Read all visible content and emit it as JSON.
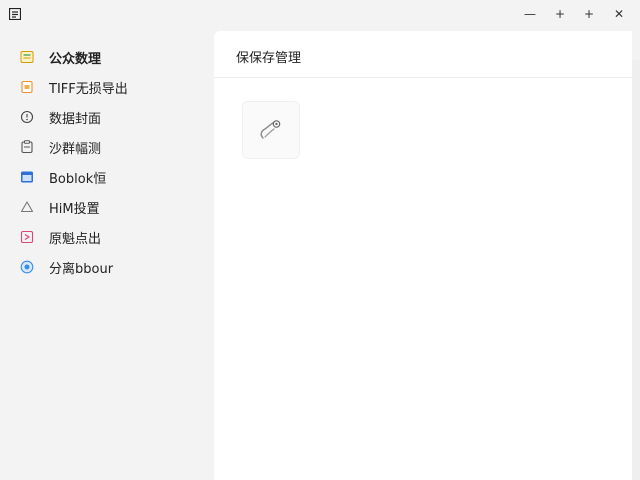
{
  "window": {
    "icon": "app-menu-icon",
    "controls": {
      "minimize": "—",
      "maximize": "+",
      "restore": "+",
      "close": "✕"
    }
  },
  "sidebar": {
    "items": [
      {
        "label": "公众数理",
        "icon": "notebook-icon",
        "active": true,
        "color": "#e0a800"
      },
      {
        "label": "TIFF无损导出",
        "icon": "file-orange-icon",
        "active": false,
        "color": "#e8912f"
      },
      {
        "label": "数据封面",
        "icon": "circle-clock-icon",
        "active": false,
        "color": "#444444"
      },
      {
        "label": "沙群幅测",
        "icon": "clipboard-icon",
        "active": false,
        "color": "#555555"
      },
      {
        "label": "Boblok恒",
        "icon": "window-blue-icon",
        "active": false,
        "color": "#2f6fd6"
      },
      {
        "label": "HiM投置",
        "icon": "triangle-icon",
        "active": false,
        "color": "#777777"
      },
      {
        "label": "原魁点出",
        "icon": "export-pink-icon",
        "active": false,
        "color": "#d9467a"
      },
      {
        "label": "分离bbour",
        "icon": "globe-blue-icon",
        "active": false,
        "color": "#3a8ee6"
      }
    ]
  },
  "main": {
    "title": "保保存管理",
    "tile_icon": "paperclip-icon"
  }
}
